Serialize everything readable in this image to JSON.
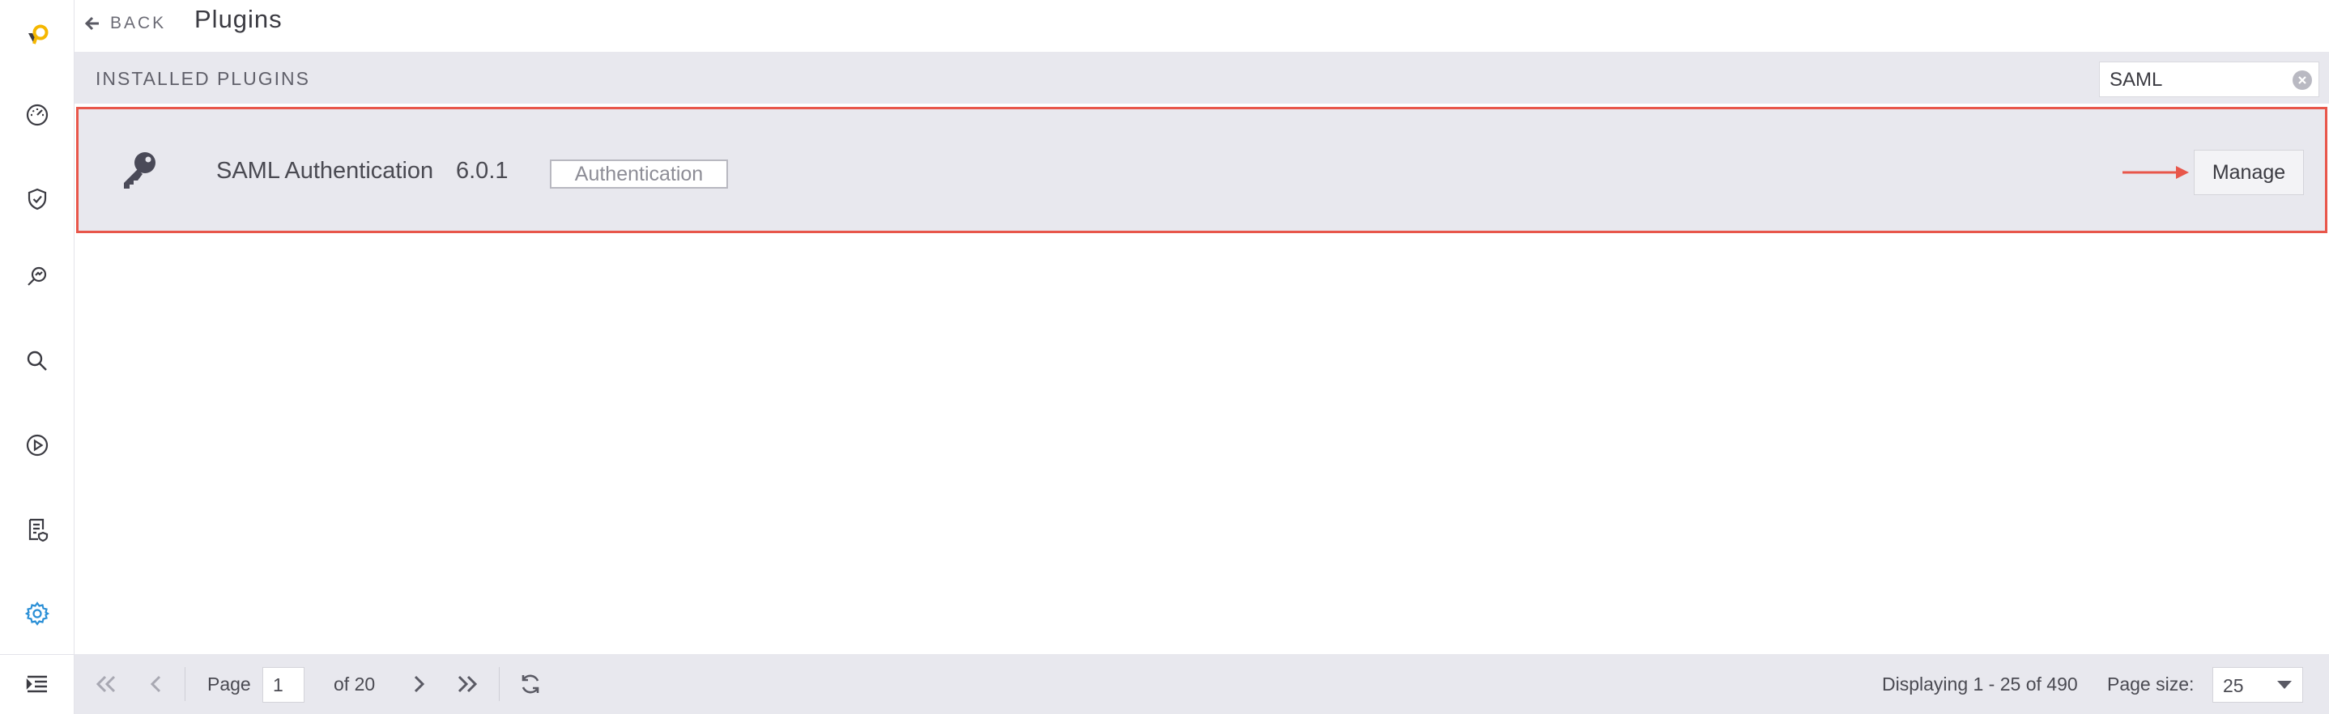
{
  "sidebar": {
    "icons": [
      "logo-icon",
      "dashboard-gauge-icon",
      "shield-check-icon",
      "investigate-search-icon",
      "search-icon",
      "play-circle-icon",
      "reports-icon",
      "settings-gear-icon",
      "menu-expand-icon"
    ],
    "active_item": "settings-gear-icon",
    "accent_color": "#2a8fd6",
    "logo_color": "#f5b700"
  },
  "header": {
    "back_label": "BACK",
    "title": "Plugins"
  },
  "toolbar": {
    "section_heading": "INSTALLED PLUGINS",
    "search_value": "SAML"
  },
  "plugin": {
    "icon": "key-icon",
    "name": "SAML Authentication",
    "version": "6.0.1",
    "category": "Authentication",
    "manage_label": "Manage",
    "highlight_color": "#e8564a"
  },
  "pager": {
    "page_label": "Page",
    "current_page": "1",
    "of_label": "of 20",
    "display_summary": "Displaying 1 - 25 of 490",
    "page_size_label": "Page size:",
    "page_size_value": "25"
  }
}
